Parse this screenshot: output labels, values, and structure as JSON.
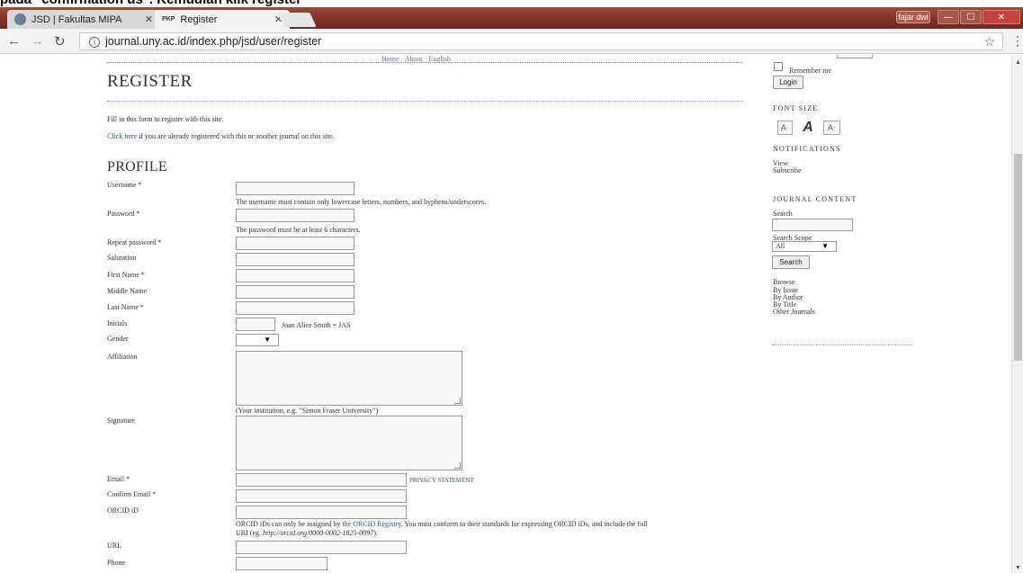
{
  "instruction": {
    "text": "pada \"confirmation us\". Kemudian klik register"
  },
  "browser": {
    "tabs": [
      {
        "label": "JSD | Fakultas MIPA",
        "icon": "uny-logo-icon"
      },
      {
        "label": "Register",
        "icon": "pkp-logo-icon",
        "favtext": "PKP"
      }
    ],
    "url": "journal.uny.ac.id/index.php/jsd/user/register",
    "user_badge": "fajar dwi"
  },
  "page": {
    "top_links": "Home · About · English",
    "title": "REGISTER",
    "intro": "Fill in this form to register with this site.",
    "click_here": "Click here",
    "click_here_rest": " if you are already registered with this or another journal on this site.",
    "profile_title": "PROFILE",
    "fields": {
      "username": "Username *",
      "username_help": "The username must contain only lowercase letters, numbers, and hyphens/underscores.",
      "password": "Password *",
      "password_help": "The password must be at least 6 characters.",
      "repeat_password": "Repeat password *",
      "salutation": "Salutation",
      "first_name": "First Name *",
      "middle_name": "Middle Name",
      "last_name": "Last Name *",
      "initials": "Initials",
      "initials_help": "Joan Alice Smith = JAS",
      "gender": "Gender",
      "affiliation": "Affiliation",
      "affiliation_help": "(Your institution, e.g. \"Simon Fraser University\")",
      "signature": "Signature",
      "email": "Email *",
      "privacy": "PRIVACY STATEMENT",
      "confirm_email": "Confirm Email *",
      "orcid": "ORCID iD",
      "orcid_help_1": "ORCID iDs can only be assigned by ",
      "orcid_link": "the ORCID Registry",
      "orcid_help_2": ". You must conform to their standards for expressing ORCID iDs, and include the full",
      "orcid_help_3": "URI (eg. ",
      "orcid_example": "http://orcid.org/0000-0002-1825-0097",
      "orcid_help_4": ").",
      "url": "URL",
      "phone": "Phone"
    }
  },
  "sidebar": {
    "remember_me": "Remember me",
    "login": "Login",
    "font_size": "FONT SIZE",
    "font_buttons": [
      "Ạ",
      "A",
      "Ȧ"
    ],
    "notifications": "NOTIFICATIONS",
    "view": "View",
    "subscribe": "Subscribe",
    "journal_content": "JOURNAL CONTENT",
    "search_label": "Search",
    "search_scope": "Search Scope",
    "scope_value": "All",
    "search_button": "Search",
    "browse": "Browse",
    "by_issue": "By Issue",
    "by_author": "By Author",
    "by_title": "By Title",
    "other_journals": "Other Journals"
  }
}
